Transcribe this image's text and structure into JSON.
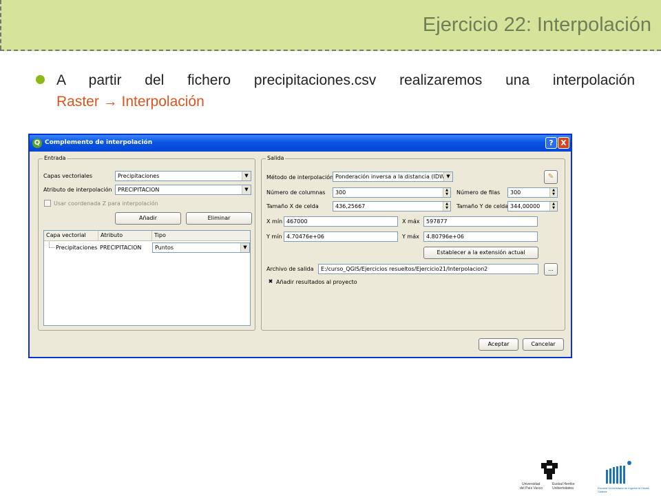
{
  "slide": {
    "title": "Ejercicio 22: Interpolación",
    "bullet_line1": "A partir del fichero precipitaciones.csv realizaremos una interpolación",
    "bullet_line2": "Raster → Interpolación"
  },
  "dialog": {
    "title": "Complemento de interpolación",
    "help_label": "?",
    "close_label": "X",
    "entrada": {
      "group_label": "Entrada",
      "capas_label": "Capas vectoriales",
      "capas_value": "Precipitaciones",
      "atributo_label": "Atributo de interpolación",
      "atributo_value": "PRECIPITACION",
      "usar_z_label": "Usar coordenada Z para interpolación",
      "add_label": "Añadir",
      "remove_label": "Eliminar",
      "table": {
        "headers": [
          "Capa vectorial",
          "Atributo",
          "Tipo"
        ],
        "row": {
          "capa": "Precipitaciones",
          "atributo": "PRECIPITACION",
          "tipo": "Puntos"
        }
      }
    },
    "salida": {
      "group_label": "Salida",
      "metodo_label": "Método de interpolación",
      "metodo_value": "Ponderación inversa a la distancia (IDW)",
      "columnas_label": "Número de columnas",
      "columnas_value": "300",
      "filas_label": "Número de filas",
      "filas_value": "300",
      "tam_x_label": "Tamaño X de celda",
      "tam_x_value": "436,25667",
      "tam_y_label": "Tamaño Y de celda",
      "tam_y_value": "344,00000",
      "xmin_label": "X mín",
      "xmin_value": "467000",
      "xmax_label": "X máx",
      "xmax_value": "597877",
      "ymin_label": "Y mín",
      "ymin_value": "4.70476e+06",
      "ymax_label": "Y máx",
      "ymax_value": "4.80796e+06",
      "extent_button": "Establecer a la extensión actual",
      "archivo_label": "Archivo de salida",
      "archivo_value": "E:/curso_QGIS/Ejercicios resueltos/Ejercicio21/Interpolacion2",
      "browse_label": "...",
      "add_results_label": "Añadir resultados al proyecto",
      "add_results_check": "✖"
    },
    "accept_label": "Aceptar",
    "cancel_label": "Cancelar"
  },
  "logos": {
    "upv_line1": "Universidad",
    "upv_line2": "del País Vasco",
    "upv_line3": "Euskal Herriko",
    "upv_line4": "Unibertsitatea",
    "eui_line1": "Escuela Universitaria de Ingeniería Vitoria-Gasteiz"
  }
}
